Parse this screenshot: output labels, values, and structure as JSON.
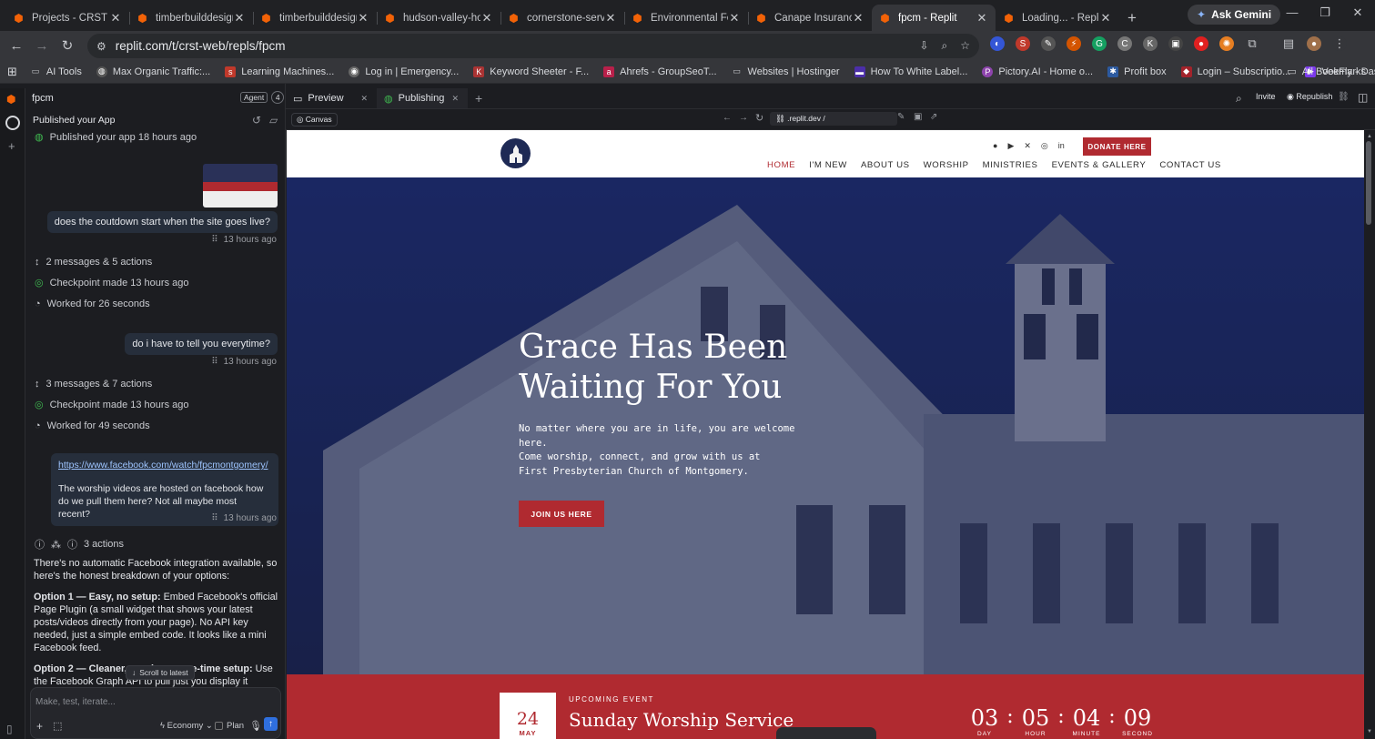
{
  "browser": {
    "tabs": [
      {
        "title": "Projects - CRST Web",
        "active": false
      },
      {
        "title": "timberbuilddesign",
        "active": false
      },
      {
        "title": "timberbuilddesign",
        "active": false
      },
      {
        "title": "hudson-valley-hot",
        "active": false
      },
      {
        "title": "cornerstone-servi",
        "active": false
      },
      {
        "title": "Environmental For",
        "active": false
      },
      {
        "title": "Canape Insurance",
        "active": false
      },
      {
        "title": "fpcm - Replit",
        "active": true
      },
      {
        "title": "Loading... - Replit",
        "active": false
      }
    ],
    "gemini_label": "Ask Gemini",
    "url": "replit.com/t/crst-web/repls/fpcm",
    "bookmarks": [
      "AI Tools",
      "Max Organic Traffic:...",
      "Learning Machines...",
      "Log in | Emergency...",
      "Keyword Sheeter - F...",
      "Ahrefs - GroupSeoT...",
      "Websites | Hostinger",
      "How To White Label...",
      "Pictory.AI - Home o...",
      "Profit box",
      "Login – Subscriptio...",
      "VeeFly - Dashboard"
    ],
    "all_bookmarks": "All Bookmarks"
  },
  "replit": {
    "project_name": "fpcm",
    "agent_label": "Agent",
    "agent_count": "4",
    "section_title": "Published your App",
    "published_status": "Published your app 18 hours ago",
    "messages": [
      {
        "text": "does the coutdown start when the site goes live?",
        "time": "13 hours ago"
      },
      {
        "text": "do i have to tell you everytime?",
        "time": "13 hours ago"
      },
      {
        "link": "https://www.facebook.com/watch/fpcmontgomery/",
        "text": "The worship videos are hosted on facebook how do we pull them here? Not all maybe most recent?",
        "time": "13 hours ago"
      }
    ],
    "group1": {
      "summary": "2 messages & 5 actions",
      "checkpoint": "Checkpoint made 13 hours ago",
      "worked": "Worked for 26 seconds"
    },
    "group2": {
      "summary": "3 messages & 7 actions",
      "checkpoint": "Checkpoint made 13 hours ago",
      "worked": "Worked for 49 seconds"
    },
    "actions_count": "3 actions",
    "reply": {
      "intro": "There's no automatic Facebook integration available, so here's the honest breakdown of your options:",
      "opt1_label": "Option 1 — Easy, no setup:",
      "opt1_text": " Embed Facebook's official Page Plugin (a small widget that shows your latest posts/videos directly from your page). No API key needed, just a simple embed code. It looks like a mini Facebook feed.",
      "opt2_label": "Option 2 — Cleaner, requires a one-time setup:",
      "opt2_text": " Use the Facebook Graph API to pull just you",
      "opt2_tail": "display it natively on the site (thumbnail, title, embedded player). This needs a Facebook"
    },
    "scroll_latest": "Scroll to latest",
    "composer": {
      "placeholder": "Make, test, iterate...",
      "mode": "Economy",
      "plan": "Plan"
    },
    "preview_tabs": [
      "Preview",
      "Publishing"
    ],
    "invite": "Invite",
    "republish": "Republish",
    "canvas": "Canvas",
    "preview_url": ".replit.dev /"
  },
  "site": {
    "donate": "DONATE HERE",
    "nav": [
      "HOME",
      "I'M NEW",
      "ABOUT US",
      "WORSHIP",
      "MINISTRIES",
      "EVENTS & GALLERY",
      "CONTACT US"
    ],
    "hero_line1": "Grace Has Been",
    "hero_line2": "Waiting For You",
    "hero_sub1": "No matter where you are in life, you are welcome",
    "hero_sub2": "here.",
    "hero_sub3": "Come worship, connect, and grow with us at",
    "hero_sub4": "First Presbyterian Church of Montgomery.",
    "cta": "JOIN US HERE",
    "event": {
      "day": "24",
      "month": "MAY",
      "kicker": "UPCOMING EVENT",
      "title": "Sunday Worship Service",
      "countdown": [
        {
          "value": "03",
          "label": "DAY"
        },
        {
          "value": "05",
          "label": "HOUR"
        },
        {
          "value": "04",
          "label": "MINUTE"
        },
        {
          "value": "09",
          "label": "SECOND"
        }
      ]
    },
    "colors": {
      "accent": "#b02a30",
      "nav_active": "#b02a30",
      "hero_overlay": "#1e2a55"
    }
  }
}
